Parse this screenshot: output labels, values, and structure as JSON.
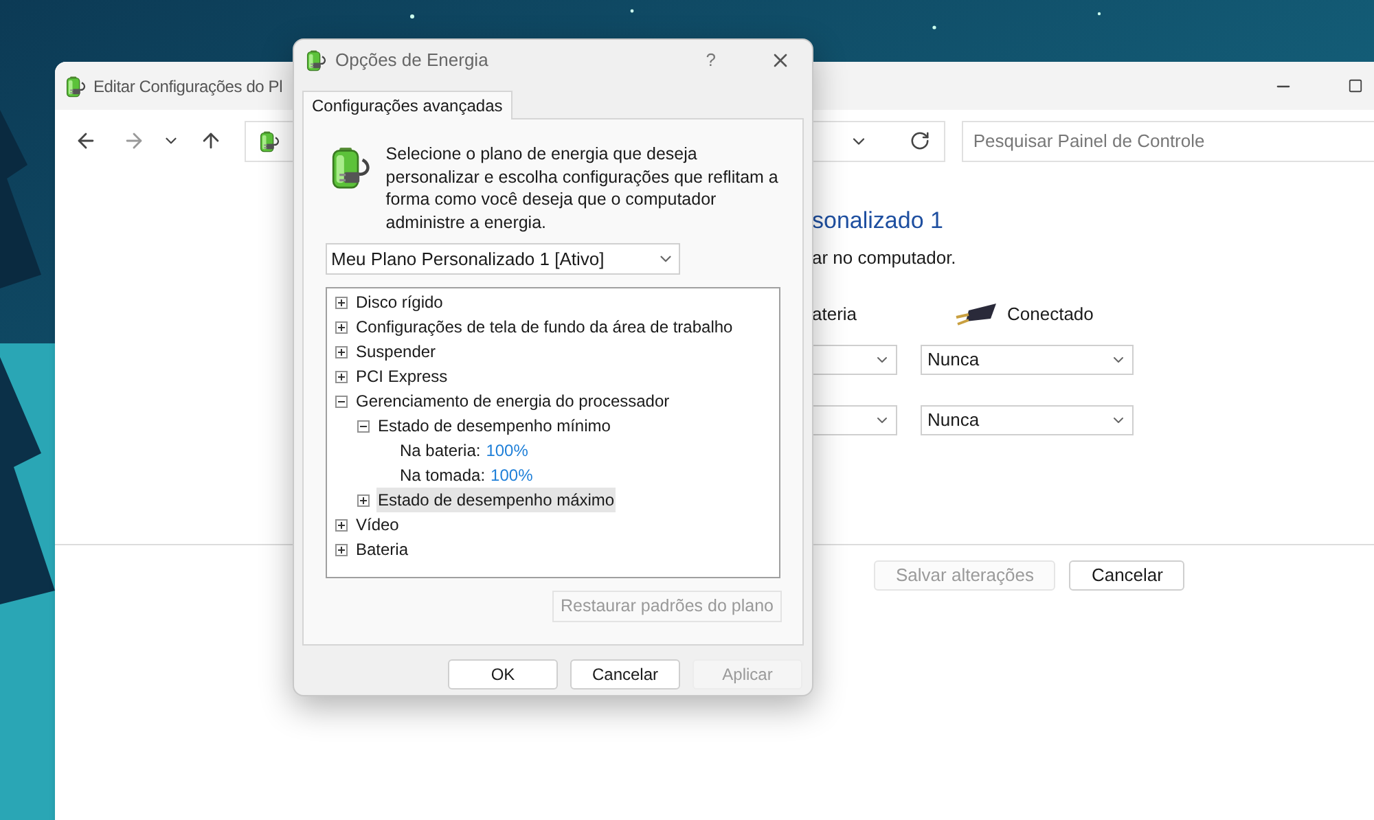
{
  "back_window": {
    "title": "Editar Configurações do Pl",
    "search": {
      "placeholder": "Pesquisar Painel de Controle"
    },
    "heading": "sonalizado 1",
    "subtitle": "ar no computador.",
    "columns": [
      {
        "label": "ateria"
      },
      {
        "label": "Conectado"
      }
    ],
    "rows": [
      {
        "value": "Nunca"
      },
      {
        "value": "Nunca"
      }
    ],
    "buttons": [
      {
        "label": "Salvar alterações",
        "disabled": true
      },
      {
        "label": "Cancelar",
        "disabled": false
      }
    ]
  },
  "dialog": {
    "title": "Opções de Energia",
    "help": "?",
    "tabs": [
      {
        "label": "Configurações avançadas",
        "selected": true
      }
    ],
    "description": "Selecione o plano de energia que deseja personalizar e escolha configurações que reflitam a forma como você deseja que o computador administre a energia.",
    "plan": "Meu Plano Personalizado 1 [Ativo]",
    "tree": [
      {
        "label": "Disco rígido",
        "expanded": false,
        "selected": false
      },
      {
        "label": "Configurações de tela de fundo da área de trabalho",
        "expanded": false,
        "selected": false
      },
      {
        "label": "Suspender",
        "expanded": false,
        "selected": false
      },
      {
        "label": "PCI Express",
        "expanded": false,
        "selected": false
      },
      {
        "label": "Gerenciamento de energia do processador",
        "expanded": true,
        "selected": false,
        "children": [
          {
            "label": "Estado de desempenho mínimo",
            "expanded": true,
            "selected": false,
            "children": [
              {
                "label": "Na bateria:",
                "value": "100%",
                "selected": false
              },
              {
                "label": "Na tomada:",
                "value": "100%",
                "selected": false
              }
            ]
          },
          {
            "label": "Estado de desempenho máximo",
            "expanded": false,
            "selected": true
          }
        ]
      },
      {
        "label": "Vídeo",
        "expanded": false,
        "selected": false
      },
      {
        "label": "Bateria",
        "expanded": false,
        "selected": false
      }
    ],
    "restore_button": {
      "label": "Restaurar padrões do plano",
      "disabled": true
    },
    "buttons": [
      {
        "label": "OK",
        "disabled": false
      },
      {
        "label": "Cancelar",
        "disabled": false
      },
      {
        "label": "Aplicar",
        "disabled": true
      }
    ]
  }
}
